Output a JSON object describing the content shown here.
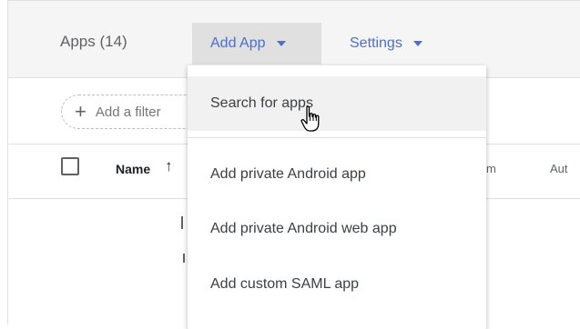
{
  "header": {
    "title": "Apps (14)",
    "add_app_label": "Add App",
    "settings_label": "Settings"
  },
  "filter": {
    "placeholder": "Add a filter"
  },
  "table": {
    "columns": [
      "Name",
      "m",
      "Aut"
    ]
  },
  "dropdown": {
    "items": [
      "Search for apps",
      "Add private Android app",
      "Add private Android web app",
      "Add custom SAML app"
    ]
  },
  "colors": {
    "accent": "#4a6fd0",
    "header_bg": "#f5f5f5",
    "button_active_bg": "#e0e0e0"
  },
  "icons": {
    "sort": "arrow-up-icon",
    "filter_add": "plus-icon",
    "cursor": "hand-pointer-icon"
  }
}
